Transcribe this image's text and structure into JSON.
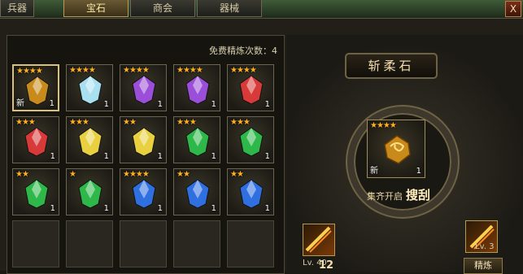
{
  "tabs": [
    {
      "label": "兵器",
      "active": false
    },
    {
      "label": "宝石",
      "active": true
    },
    {
      "label": "商会",
      "active": false
    },
    {
      "label": "器械",
      "active": false
    }
  ],
  "close_label": "X",
  "free_refine_label": "免费精炼次数：4",
  "grid": [
    [
      {
        "stars": "★★★★",
        "gem": "amber",
        "count": "1",
        "new": "新",
        "selected": true
      },
      {
        "stars": "★★★★",
        "gem": "white",
        "count": "1"
      },
      {
        "stars": "★★★★",
        "gem": "purple",
        "count": "1"
      },
      {
        "stars": "★★★★",
        "gem": "purple",
        "count": "1"
      },
      {
        "stars": "★★★★",
        "gem": "red",
        "count": "1"
      }
    ],
    [
      {
        "stars": "★★★",
        "gem": "red",
        "count": "1"
      },
      {
        "stars": "★★★",
        "gem": "yellow",
        "count": "1"
      },
      {
        "stars": "★★",
        "gem": "yellow",
        "count": "1"
      },
      {
        "stars": "★★★",
        "gem": "green",
        "count": "1"
      },
      {
        "stars": "★★★",
        "gem": "green",
        "count": "1"
      }
    ],
    [
      {
        "stars": "★★",
        "gem": "green",
        "count": "1"
      },
      {
        "stars": "★",
        "gem": "green",
        "count": "1"
      },
      {
        "stars": "★★★★",
        "gem": "blue",
        "count": "1"
      },
      {
        "stars": "★★",
        "gem": "blue",
        "count": "1"
      },
      {
        "stars": "★★",
        "gem": "blue",
        "count": "1"
      }
    ],
    [
      null,
      null,
      null,
      null,
      null
    ]
  ],
  "gem_colors": {
    "amber": "#c88a1a",
    "white": "#a8e0f0",
    "purple": "#9b4fd8",
    "red": "#d83a3a",
    "yellow": "#e8d040",
    "green": "#2fb84a",
    "blue": "#2f6fe0"
  },
  "right": {
    "title": "斩柔石",
    "center": {
      "stars": "★★★★",
      "new": "新",
      "count": "1"
    },
    "ceremony_small": "集齐开启",
    "ceremony_big": "搜刮",
    "left_skill_level": "Lv. 40",
    "right_skill_level": "Lv. 3",
    "refine_label": "精炼",
    "bottom_number": "12"
  }
}
